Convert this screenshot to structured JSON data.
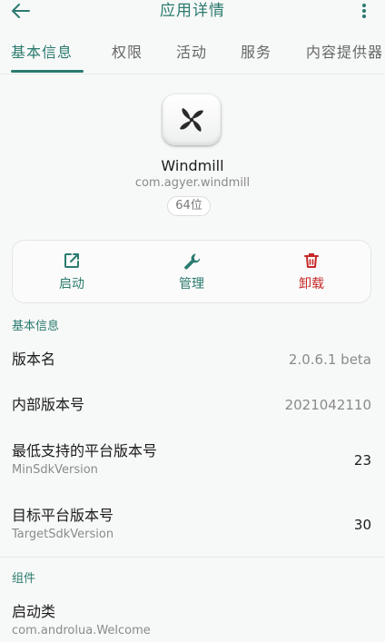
{
  "appbar": {
    "title": "应用详情"
  },
  "tabs": [
    "基本信息",
    "权限",
    "活动",
    "服务",
    "内容提供器"
  ],
  "app": {
    "name": "Windmill",
    "package": "com.agyer.windmill",
    "arch": "64位"
  },
  "actions": [
    {
      "label": "启动",
      "icon": "launch-icon"
    },
    {
      "label": "管理",
      "icon": "wrench-icon"
    },
    {
      "label": "卸载",
      "icon": "trash-icon"
    }
  ],
  "basic": {
    "header": "基本信息",
    "rows": [
      {
        "label": "版本名",
        "sub": "",
        "value": "2.0.6.1 beta"
      },
      {
        "label": "内部版本号",
        "sub": "",
        "value": "2021042110"
      },
      {
        "label": "最低支持的平台版本号",
        "sub": "MinSdkVersion",
        "value": "23"
      },
      {
        "label": "目标平台版本号",
        "sub": "TargetSdkVersion",
        "value": "30"
      }
    ]
  },
  "components": {
    "header": "组件",
    "rows": [
      {
        "label": "启动类",
        "sub": "com.androlua.Welcome"
      }
    ]
  },
  "colors": {
    "accent": "#2b7a6f",
    "danger": "#c62828"
  }
}
